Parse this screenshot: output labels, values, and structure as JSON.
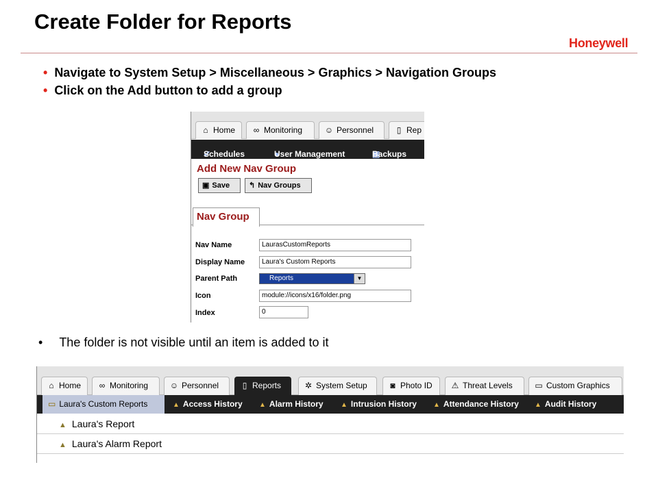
{
  "slide": {
    "title": "Create Folder for Reports",
    "brand": "Honeywell",
    "bullets": [
      "Navigate to System Setup > Miscellaneous > Graphics > Navigation Groups",
      "Click on the Add button to add a group"
    ],
    "note": "The folder is not visible until an item is added to it",
    "bullet_glyph": "•"
  },
  "screen1": {
    "tabs": [
      {
        "label": "Home",
        "icon": "home-icon",
        "glyph": "⌂"
      },
      {
        "label": "Monitoring",
        "icon": "glasses-icon",
        "glyph": "∞"
      },
      {
        "label": "Personnel",
        "icon": "people-icon",
        "glyph": "☺"
      },
      {
        "label": "Rep",
        "icon": "document-icon",
        "glyph": "▯"
      }
    ],
    "subnav": [
      {
        "label": "Schedules",
        "icon": "schedule-icon",
        "glyph": "✔"
      },
      {
        "label": "User Management",
        "icon": "user-icon",
        "glyph": "●"
      },
      {
        "label": "Backups",
        "icon": "backup-icon",
        "glyph": "▣"
      }
    ],
    "header": "Add New Nav Group",
    "buttons": [
      {
        "label": "Save",
        "icon": "save-icon",
        "glyph": "▣"
      },
      {
        "label": "Nav Groups",
        "icon": "back-icon",
        "glyph": "↰"
      }
    ],
    "form_tab": "Nav Group",
    "fields": {
      "nav_name": {
        "label": "Nav Name",
        "value": "LaurasCustomReports"
      },
      "display_name": {
        "label": "Display Name",
        "value": "Laura's Custom Reports"
      },
      "parent_path": {
        "label": "Parent Path",
        "value": "Reports"
      },
      "icon": {
        "label": "Icon",
        "value": "module://icons/x16/folder.png"
      },
      "index": {
        "label": "Index",
        "value": "0"
      }
    },
    "dropdown_glyph": "▼"
  },
  "screen2": {
    "tabs": [
      {
        "label": "Home",
        "icon": "home-icon",
        "glyph": "⌂"
      },
      {
        "label": "Monitoring",
        "icon": "glasses-icon",
        "glyph": "∞"
      },
      {
        "label": "Personnel",
        "icon": "people-icon",
        "glyph": "☺"
      },
      {
        "label": "Reports",
        "icon": "document-icon",
        "glyph": "▯",
        "active": true
      },
      {
        "label": "System Setup",
        "icon": "gear-icon",
        "glyph": "✲"
      },
      {
        "label": "Photo ID",
        "icon": "camera-icon",
        "glyph": "◙"
      },
      {
        "label": "Threat Levels",
        "icon": "warning-icon",
        "glyph": "⚠"
      },
      {
        "label": "Custom Graphics",
        "icon": "folder-icon",
        "glyph": "▭"
      }
    ],
    "navitems": [
      {
        "label": "Laura's Custom Reports",
        "icon": "folder-icon",
        "glyph": "▭",
        "selected": true
      },
      {
        "label": "Access History",
        "icon": "report-icon",
        "glyph": "▲"
      },
      {
        "label": "Alarm History",
        "icon": "alarm-report-icon",
        "glyph": "▲"
      },
      {
        "label": "Intrusion History",
        "icon": "report-icon",
        "glyph": "▲"
      },
      {
        "label": "Attendance History",
        "icon": "report-icon",
        "glyph": "▲"
      },
      {
        "label": "Audit History",
        "icon": "report-icon",
        "glyph": "▲"
      }
    ],
    "rows": [
      {
        "label": "Laura's Report",
        "icon": "report-icon",
        "glyph": "▲"
      },
      {
        "label": "Laura's Alarm Report",
        "icon": "alarm-report-icon",
        "glyph": "▲"
      }
    ]
  }
}
